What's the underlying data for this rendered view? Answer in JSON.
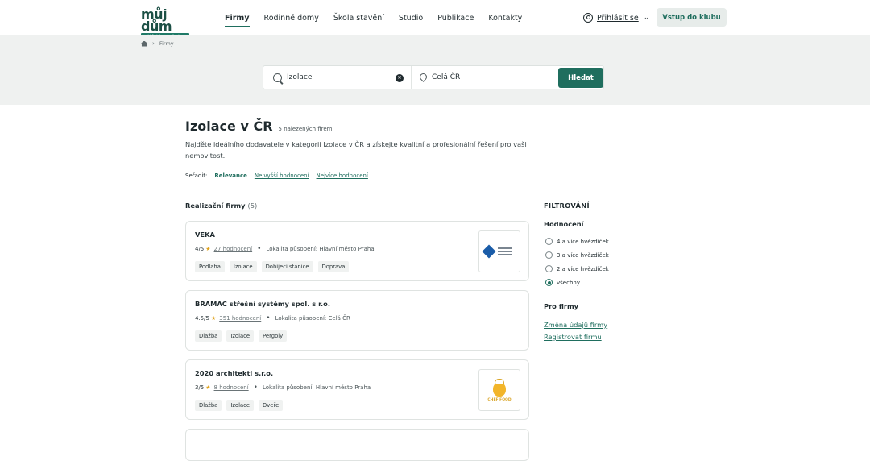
{
  "header": {
    "logo_text": "můj dům",
    "logo_sub": "Váš klub za bydlením",
    "nav": [
      "Firmy",
      "Rodinné domy",
      "Škola stavění",
      "Studio",
      "Publikace",
      "Kontakty"
    ],
    "login_label": "Přihlásit se",
    "club_button": "Vstup do klubu",
    "accent_color": "#1f6e5e"
  },
  "breadcrumb": {
    "current": "Firmy"
  },
  "search": {
    "query": "Izolace",
    "location": "Celá ČR",
    "button": "Hledat"
  },
  "main": {
    "title": "Izolace v ČR",
    "count": "5 nalezených firem",
    "description": "Najděte ideálního dodavatele v kategorii Izolace v ČR a získejte kvalitní a profesionální řešení pro vaši nemovitost.",
    "sort_label": "Seřadit:",
    "sort_options": [
      "Relevance",
      "Nejvyšší hodnocení",
      "Nejvíce hodnocení"
    ],
    "section_title": "Realizační firmy",
    "section_count": "(5)"
  },
  "companies": [
    {
      "name": "VEKA",
      "score": "4/5",
      "reviews": "27 hodnocení",
      "location": "Lokalita působení: Hlavní město Praha",
      "tags": [
        "Podlaha",
        "Izolace",
        "Dobíjecí stanice",
        "Doprava"
      ],
      "logo": "veka-logo"
    },
    {
      "name": "BRAMAC střešní systémy spol. s r.o.",
      "score": "4.5/5",
      "reviews": "351 hodnocení",
      "location": "Lokalita působení: Celá ČR",
      "tags": [
        "Dlažba",
        "Izolace",
        "Pergoly"
      ],
      "logo": ""
    },
    {
      "name": "2020 architekti s.r.o.",
      "score": "3/5",
      "reviews": "8 hodnocení",
      "location": "Lokalita působení: Hlavní město Praha",
      "tags": [
        "Dlažba",
        "Izolace",
        "Dveře"
      ],
      "logo": "chef-logo",
      "logo_text": "CHEF FOOD"
    }
  ],
  "sidebar": {
    "filter_title": "FILTROVÁNÍ",
    "rating_title": "Hodnocení",
    "rating_options": [
      "4 a více hvězdiček",
      "3 a více hvězdiček",
      "2 a více hvězdiček",
      "všechny"
    ],
    "selected_rating": "všechny",
    "pro_title": "Pro firmy",
    "pro_links": [
      "Změna údajů firmy",
      "Registrovat firmu"
    ]
  }
}
